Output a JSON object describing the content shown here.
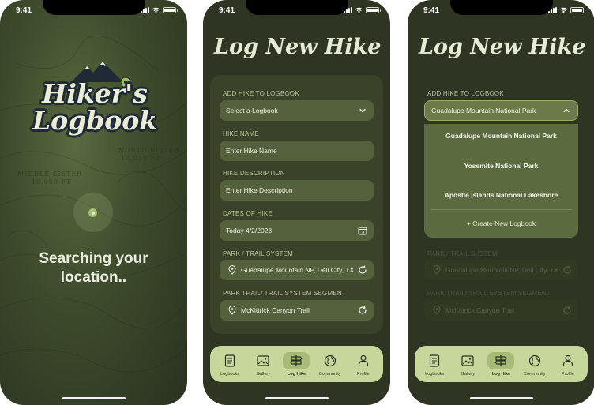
{
  "status_time": "9:41",
  "splash": {
    "logo_line1": "Hiker's",
    "logo_line2": "Logbook",
    "search_line1": "Searching your",
    "search_line2": "location..",
    "map_labels": [
      "NORTH SISTER",
      "10,053 FT",
      "MIDDLE SISTER",
      "10,050 FT"
    ]
  },
  "form": {
    "title": "Log New Hike",
    "logbook_label": "ADD HIKE TO LOGBOOK",
    "logbook_placeholder": "Select a Logbook",
    "name_label": "HIKE NAME",
    "name_placeholder": "Enter Hike Name",
    "desc_label": "HIKE DESCRIPTION",
    "desc_placeholder": "Enter Hike Description",
    "dates_label": "DATES OF HIKE",
    "dates_value": "Today 4/2/2023",
    "park_label": "PARK / TRAIL SYSTEM",
    "park_value": "Guadalupe Mountain NP, Dell City, TX",
    "segment_label": "PARK TRAIL/ TRAIL SYSTEM SEGMENT",
    "segment_value": "McKittrick Canyon Trail"
  },
  "dropdown": {
    "selected": "Guadalupe Mountain National Park",
    "options": [
      "Guadalupe Mountain National Park",
      "Yosemite National Park",
      "Apostle Islands National Lakeshore"
    ],
    "create_label": "Create New Logbook"
  },
  "tabs": [
    {
      "label": "Logbooks",
      "icon": "logbook-icon"
    },
    {
      "label": "Gallery",
      "icon": "gallery-icon"
    },
    {
      "label": "Log Hike",
      "icon": "signpost-icon"
    },
    {
      "label": "Community",
      "icon": "globe-icon"
    },
    {
      "label": "Profile",
      "icon": "person-icon"
    }
  ],
  "active_tab": "Log Hike",
  "colors": {
    "accent": "#c7d69b",
    "field": "#55613d",
    "background": "#2e3522"
  }
}
